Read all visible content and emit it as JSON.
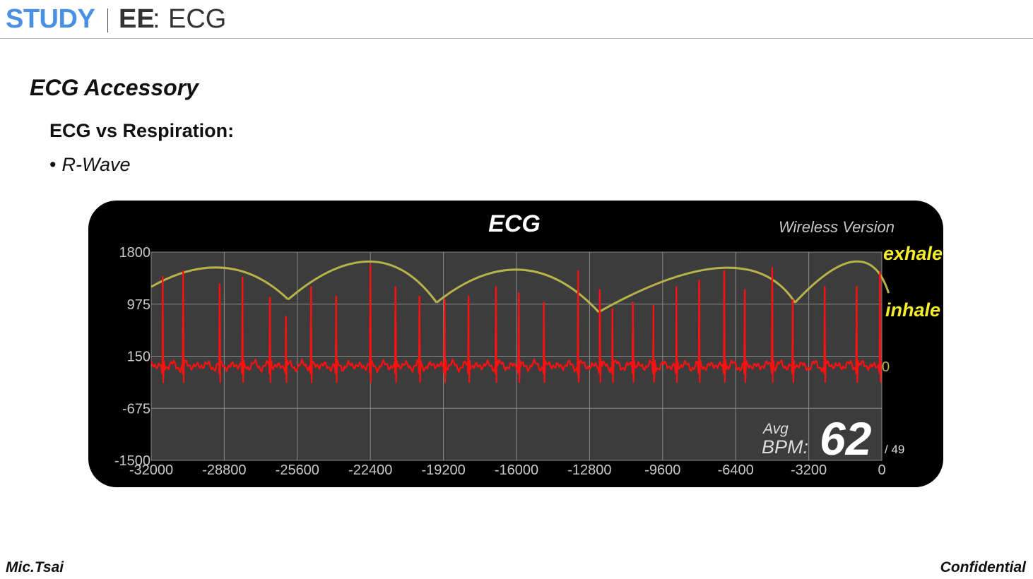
{
  "header": {
    "study": "STUDY",
    "ee": "EE",
    "colon": ":",
    "topic": "ECG"
  },
  "section": {
    "title": "ECG Accessory",
    "subtitle": "ECG vs Respiration:",
    "bullet": "R-Wave"
  },
  "footer": {
    "author": "Mic.Tsai",
    "label": "Confidential"
  },
  "monitor": {
    "title": "ECG",
    "version": "Wireless Version",
    "bpm_label_top": "Avg",
    "bpm_label_bottom": "BPM:",
    "bpm_value": "62",
    "bpm_sub": "/ 49",
    "zero_marker": "0",
    "annotations": {
      "exhale": "exhale",
      "inhale": "inhale"
    },
    "colors": {
      "trace": "#ff1010",
      "envelope": "#b8b24a",
      "annotation": "#f5ec2a",
      "plot_bg": "#3c3c3c",
      "grid": "#8a8a8a"
    }
  },
  "chart_data": {
    "type": "line",
    "title": "ECG",
    "xlabel": "",
    "ylabel": "",
    "xlim": [
      -32000,
      0
    ],
    "ylim": [
      -1500,
      1800
    ],
    "x_ticks": [
      -32000,
      -28800,
      -25600,
      -22400,
      -19200,
      -16000,
      -12800,
      -9600,
      -6400,
      -3200,
      0
    ],
    "x_tick_labels": [
      "-32000",
      "-28800",
      "-25600",
      "-22400",
      "-19200",
      "-16000",
      "-12800",
      "-9600",
      "-6400",
      "-3200",
      "0"
    ],
    "y_ticks": [
      1800,
      975,
      150,
      -675,
      -1500
    ],
    "y_tick_labels": [
      "1800",
      "975",
      "150",
      "-675",
      "-1500"
    ],
    "grid": true,
    "baseline": 0,
    "r_peaks": {
      "x": [
        -31500,
        -30600,
        -29000,
        -28000,
        -26800,
        -26100,
        -25000,
        -23900,
        -22400,
        -21300,
        -20250,
        -19150,
        -18100,
        -16900,
        -15900,
        -14800,
        -13300,
        -12350,
        -11800,
        -10900,
        -10000,
        -9000,
        -8000,
        -6900,
        -6000,
        -4800,
        -3900,
        -2500,
        -1100,
        -80
      ],
      "y": [
        1410,
        1500,
        1290,
        1400,
        1080,
        780,
        1250,
        1100,
        1600,
        1250,
        1100,
        1050,
        1100,
        1250,
        1150,
        1000,
        1500,
        1200,
        900,
        1000,
        950,
        1250,
        1350,
        1500,
        1200,
        1550,
        1050,
        1250,
        1250,
        1480
      ]
    },
    "respiration_envelope": [
      {
        "x": [
          -32000,
          -28800,
          -26000
        ],
        "y": [
          1250,
          1550,
          1050
        ]
      },
      {
        "x": [
          -26000,
          -22400,
          -19500
        ],
        "y": [
          1050,
          1650,
          1000
        ]
      },
      {
        "x": [
          -19500,
          -15800,
          -12400
        ],
        "y": [
          1000,
          1520,
          850
        ]
      },
      {
        "x": [
          -12400,
          -7000,
          -3800
        ],
        "y": [
          850,
          1550,
          1000
        ]
      },
      {
        "x": [
          -3800,
          -1200,
          300
        ],
        "y": [
          1000,
          1650,
          1150
        ]
      }
    ]
  }
}
